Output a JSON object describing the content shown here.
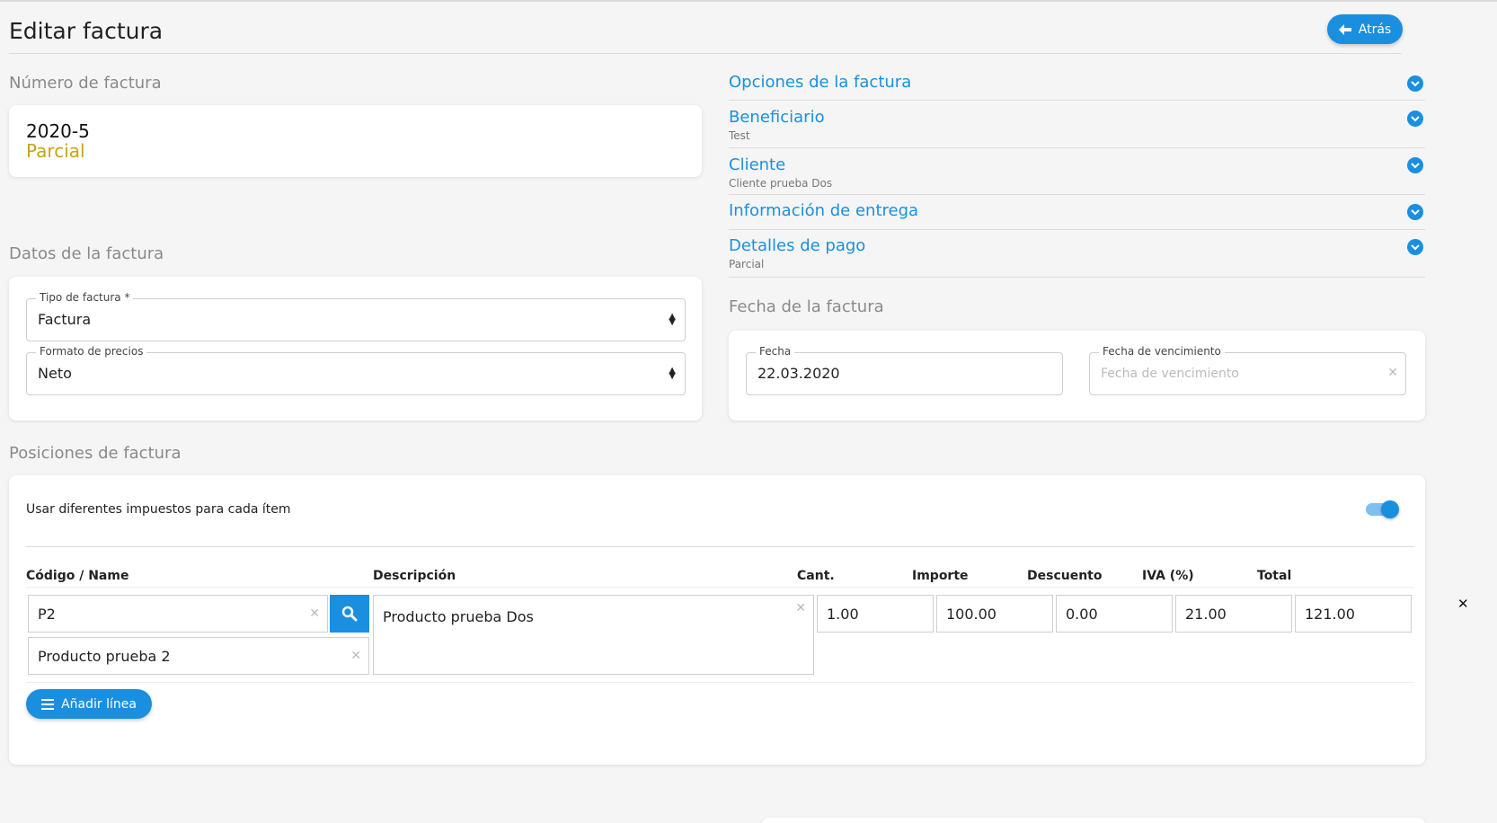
{
  "header": {
    "title": "Editar factura",
    "back_label": "Atrás"
  },
  "invoice_number": {
    "section_label": "Número de factura",
    "number": "2020-5",
    "status": "Parcial"
  },
  "accordion": [
    {
      "title": "Opciones de la factura",
      "subtitle": ""
    },
    {
      "title": "Beneficiario",
      "subtitle": "Test"
    },
    {
      "title": "Cliente",
      "subtitle": "Cliente prueba Dos"
    },
    {
      "title": "Información de entrega",
      "subtitle": ""
    },
    {
      "title": "Detalles de pago",
      "subtitle": "Parcial"
    }
  ],
  "invoice_data": {
    "section_label": "Datos de la factura",
    "type_label": "Tipo de factura *",
    "type_value": "Factura",
    "price_format_label": "Formato de precios",
    "price_format_value": "Neto"
  },
  "invoice_date": {
    "section_label": "Fecha de la factura",
    "date_label": "Fecha",
    "date_value": "22.03.2020",
    "due_label": "Fecha de vencimiento",
    "due_placeholder": "Fecha de vencimiento"
  },
  "positions": {
    "section_label": "Posiciones de factura",
    "toggle_label": "Usar diferentes impuestos para cada ítem",
    "toggle_on": true,
    "columns": [
      "Código / Name",
      "Descripción",
      "Cant.",
      "Importe",
      "Descuento",
      "IVA (%)",
      "Total"
    ],
    "row": {
      "code": "P2",
      "name": "Producto prueba 2",
      "description": "Producto prueba Dos",
      "qty": "1.00",
      "amount": "100.00",
      "discount": "0.00",
      "vat": "21.00",
      "total": "121.00"
    },
    "add_line_label": "Añadir línea"
  },
  "colors": {
    "accent": "#1a8fe0",
    "status": "#c8a21b"
  }
}
